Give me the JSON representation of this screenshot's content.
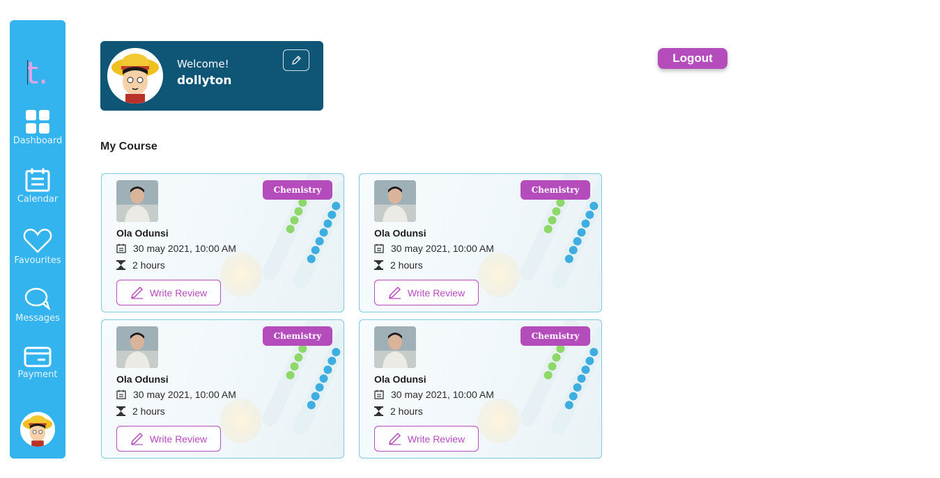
{
  "sidebar": {
    "logo": "t.",
    "items": [
      {
        "label": "Dashboard"
      },
      {
        "label": "Calendar"
      },
      {
        "label": "Favourites"
      },
      {
        "label": "Messages"
      },
      {
        "label": "Payment"
      }
    ]
  },
  "welcome": {
    "greeting": "Welcome!",
    "username": "dollyton"
  },
  "header": {
    "logout_label": "Logout"
  },
  "section": {
    "title": "My Course"
  },
  "courses": [
    {
      "tag": "Chemistry",
      "tutor": "Ola Odunsi",
      "datetime": "30 may 2021, 10:00 AM",
      "duration": "2 hours",
      "review_label": "Write Review"
    },
    {
      "tag": "Chemistry",
      "tutor": "Ola Odunsi",
      "datetime": "30 may 2021, 10:00 AM",
      "duration": "2 hours",
      "review_label": "Write Review"
    },
    {
      "tag": "Chemistry",
      "tutor": "Ola Odunsi",
      "datetime": "30 may 2021, 10:00 AM",
      "duration": "2 hours",
      "review_label": "Write Review"
    },
    {
      "tag": "Chemistry",
      "tutor": "Ola Odunsi",
      "datetime": "30 may 2021, 10:00 AM",
      "duration": "2 hours",
      "review_label": "Write Review"
    }
  ],
  "colors": {
    "sidebar": "#34b4ee",
    "welcome_card": "#0f5575",
    "accent": "#b44dbb"
  }
}
